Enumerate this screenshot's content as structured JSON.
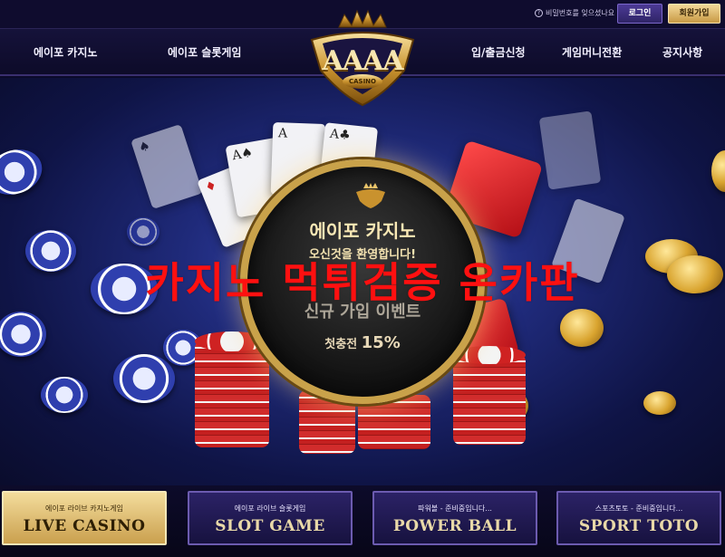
{
  "topbar": {
    "forgot_password": "비밀번호를 잊으셨나요",
    "login_label": "로그인",
    "join_label": "회원가입"
  },
  "nav": {
    "left": [
      "에이포 카지노",
      "에이포 슬롯게임"
    ],
    "right": [
      "입/출금신청",
      "게임머니전환",
      "공지사항"
    ]
  },
  "logo": {
    "text": "AAAA",
    "sub": "CASINO"
  },
  "hero": {
    "medallion": {
      "title": "에이포 카지노",
      "welcome": "오신것을 환영합니다!",
      "event": "신규 가입 이벤트",
      "first_deposit_label": "첫충전",
      "first_deposit_value": "15%"
    },
    "overlay": "카지노 먹튀검증 온카판"
  },
  "games": [
    {
      "sub": "에이포 라이브 카지노게임",
      "title": "LIVE CASINO",
      "active": true
    },
    {
      "sub": "에이포 라이브 슬롯게임",
      "title": "SLOT GAME",
      "active": false
    },
    {
      "sub": "파워볼 - 준비중입니다...",
      "title": "POWER BALL",
      "active": false
    },
    {
      "sub": "스포츠토토 - 준비중입니다...",
      "title": "SPORT TOTO",
      "active": false
    }
  ],
  "colors": {
    "accent_gold": "#c9a24a",
    "nav_bg": "#0d0b29",
    "overlay_red": "#ff1010"
  }
}
